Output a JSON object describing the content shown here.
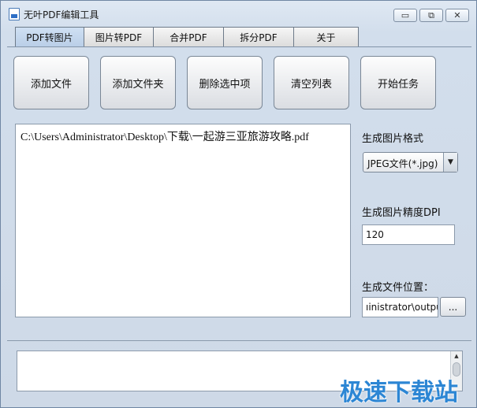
{
  "window": {
    "title": "无叶PDF编辑工具",
    "minimize_glyph": "▭",
    "restore_glyph": "⧉",
    "close_glyph": "✕"
  },
  "tabs": [
    {
      "label": "PDF转图片",
      "active": true
    },
    {
      "label": "图片转PDF",
      "active": false
    },
    {
      "label": "合并PDF",
      "active": false
    },
    {
      "label": "拆分PDF",
      "active": false
    },
    {
      "label": "关于",
      "active": false
    }
  ],
  "toolbar": {
    "add_file": "添加文件",
    "add_folder": "添加文件夹",
    "delete_selected": "删除选中项",
    "clear_list": "清空列表",
    "start_task": "开始任务"
  },
  "file_list": {
    "items": [
      "C:\\Users\\Administrator\\Desktop\\下载\\一起游三亚旅游攻略.pdf"
    ]
  },
  "settings": {
    "format_label": "生成图片格式",
    "format_value": "JPEG文件(*.jpg)",
    "dpi_label": "生成图片精度DPI",
    "dpi_value": "120",
    "output_label": "生成文件位置：",
    "output_value": "ıinistrator\\output",
    "browse_label": "..."
  },
  "watermark": "极速下载站"
}
